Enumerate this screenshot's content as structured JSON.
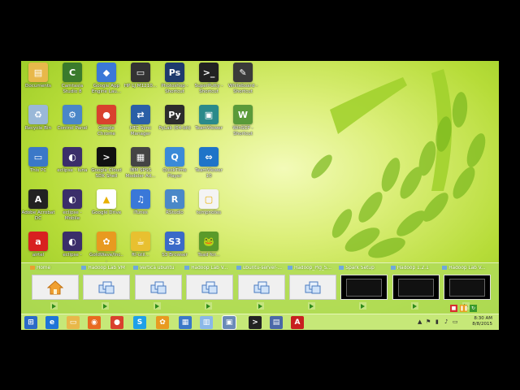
{
  "desktop_icons": [
    {
      "label": "Documents",
      "color": "#e8b84a",
      "glyph": "▤"
    },
    {
      "label": "Camtasia Studio 8",
      "color": "#3a7a2c",
      "glyph": "C"
    },
    {
      "label": "Google App Engine Lau...",
      "color": "#3b78d8",
      "glyph": "◆"
    },
    {
      "label": "HP LJ M1210...",
      "color": "#333333",
      "glyph": "▭"
    },
    {
      "label": "Photoshop - Shortcut",
      "color": "#1e3a6e",
      "glyph": "Ps"
    },
    {
      "label": "SuperPutty - Shortcut",
      "color": "#222222",
      "glyph": ">_"
    },
    {
      "label": "Whiteboard - Shortcut",
      "color": "#3a3a3a",
      "glyph": "✎"
    },
    {
      "label": "Recycle Bin",
      "color": "#9ab8d8",
      "glyph": "♻"
    },
    {
      "label": "Control Panel",
      "color": "#4a86c8",
      "glyph": "⚙"
    },
    {
      "label": "Google Chrome",
      "color": "#d9412e",
      "glyph": "●"
    },
    {
      "label": "HTC Sync Manager",
      "color": "#2a5fa6",
      "glyph": "⇄"
    },
    {
      "label": "PyLab (64-bit)",
      "color": "#2c2c2c",
      "glyph": "Py"
    },
    {
      "label": "TeamViewer",
      "color": "#2a8a8a",
      "glyph": "▣"
    },
    {
      "label": "WinSCP - Shortcut",
      "color": "#5a9a3a",
      "glyph": "W"
    },
    {
      "label": "This PC",
      "color": "#3a78c8",
      "glyph": "▭"
    },
    {
      "label": "eclipse - luna",
      "color": "#3b2e6a",
      "glyph": "◐"
    },
    {
      "label": "Google Cloud SDK Shell",
      "color": "#111111",
      "glyph": ">"
    },
    {
      "label": "IBM SPSS Modeler Ad...",
      "color": "#444444",
      "glyph": "▦"
    },
    {
      "label": "QuickTime Player",
      "color": "#3a8ad8",
      "glyph": "Q"
    },
    {
      "label": "TeamViewer 10",
      "color": "#1e74c8",
      "glyph": "⇔"
    },
    {
      "label": "Adobe Acrobat DC",
      "color": "#222222",
      "glyph": "A"
    },
    {
      "label": "eclipse - Mobile",
      "color": "#3b2e6a",
      "glyph": "◐"
    },
    {
      "label": "Google Drive",
      "color": "#ffffff",
      "glyph": "▲"
    },
    {
      "label": "iTunes",
      "color": "#3a78d8",
      "glyph": "♫"
    },
    {
      "label": "RStudio",
      "color": "#4a88c8",
      "glyph": "R"
    },
    {
      "label": "tempnotes",
      "color": "#f4f4f4",
      "glyph": "▢"
    },
    {
      "label": "airtel",
      "color": "#d82020",
      "glyph": "a"
    },
    {
      "label": "eclipse -",
      "color": "#3b2e6a",
      "glyph": "◐"
    },
    {
      "label": "GoldWave/Inc...",
      "color": "#e89a20",
      "glyph": "✿"
    },
    {
      "label": "ftl-util...",
      "color": "#e8c030",
      "glyph": "☕"
    },
    {
      "label": "S3 Browser",
      "color": "#3a6ac8",
      "glyph": "S3"
    },
    {
      "label": "Toad for...",
      "color": "#5a9a2a",
      "glyph": "🐸"
    }
  ],
  "thumbnails": [
    {
      "title": "Home",
      "type": "home"
    },
    {
      "title": "Hadoop Lab VM",
      "type": "vm"
    },
    {
      "title": "Vertica ubuntu",
      "type": "vm"
    },
    {
      "title": "Hadoop Lab V...",
      "type": "vm"
    },
    {
      "title": "ubuntu-server-...",
      "type": "vm"
    },
    {
      "title": "Hadoop_Pig_S...",
      "type": "vm"
    },
    {
      "title": "Spark Setup",
      "type": "dark"
    },
    {
      "title": "Hadoop 1.2.1",
      "type": "dark"
    },
    {
      "title": "Hadoop Lab V...",
      "type": "dark"
    }
  ],
  "taskbar": {
    "apps": [
      {
        "name": "start-button",
        "glyph": "⊞",
        "color": "#2a6ac8"
      },
      {
        "name": "internet-explorer",
        "glyph": "e",
        "color": "#1e74d8"
      },
      {
        "name": "file-explorer",
        "glyph": "▭",
        "color": "#e8b84a"
      },
      {
        "name": "firefox",
        "glyph": "◉",
        "color": "#e86a20"
      },
      {
        "name": "chrome",
        "glyph": "●",
        "color": "#d9412e"
      },
      {
        "name": "skype",
        "glyph": "S",
        "color": "#1ea0e8"
      },
      {
        "name": "goldwave",
        "glyph": "✿",
        "color": "#e89a20"
      },
      {
        "name": "network-app",
        "glyph": "▦",
        "color": "#3a78c8"
      },
      {
        "name": "notes-app",
        "glyph": "▥",
        "color": "#8ab8e8"
      },
      {
        "name": "vmware",
        "glyph": "▣",
        "color": "#6a8ab8"
      },
      {
        "name": "putty",
        "glyph": ">",
        "color": "#222222"
      },
      {
        "name": "remote-desktop",
        "glyph": "▤",
        "color": "#4a68a8"
      },
      {
        "name": "acrobat",
        "glyph": "A",
        "color": "#c82020"
      }
    ],
    "time": "8:30 AM",
    "date": "8/8/2015"
  }
}
